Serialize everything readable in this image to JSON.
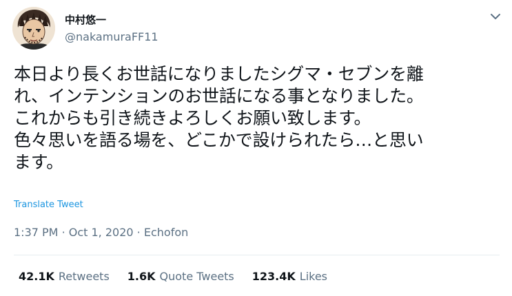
{
  "author": {
    "display_name": "中村悠一",
    "handle": "@nakamuraFF11",
    "avatar_icon": "profile-avatar"
  },
  "menu_icon": "chevron-down-icon",
  "tweet": {
    "lines": [
      "本日より長くお世話になりましたシグマ・セブンを離",
      "れ、インテンションのお世話になる事となりました。",
      "これからも引き続きよろしくお願い致します。",
      "色々思いを語る場を、どこかで設けられたら…と思い",
      "ます。"
    ]
  },
  "translate_label": "Translate Tweet",
  "meta": {
    "time": "1:37 PM",
    "separator": "·",
    "date": "Oct 1, 2020",
    "source": "Echofon"
  },
  "stats": {
    "retweets": {
      "count": "42.1K",
      "label": "Retweets"
    },
    "quotes": {
      "count": "1.6K",
      "label": "Quote Tweets"
    },
    "likes": {
      "count": "123.4K",
      "label": "Likes"
    }
  },
  "colors": {
    "text": "#0f1419",
    "secondary": "#5b7083",
    "link": "#1b95e0",
    "divider": "#e6ecf0"
  }
}
